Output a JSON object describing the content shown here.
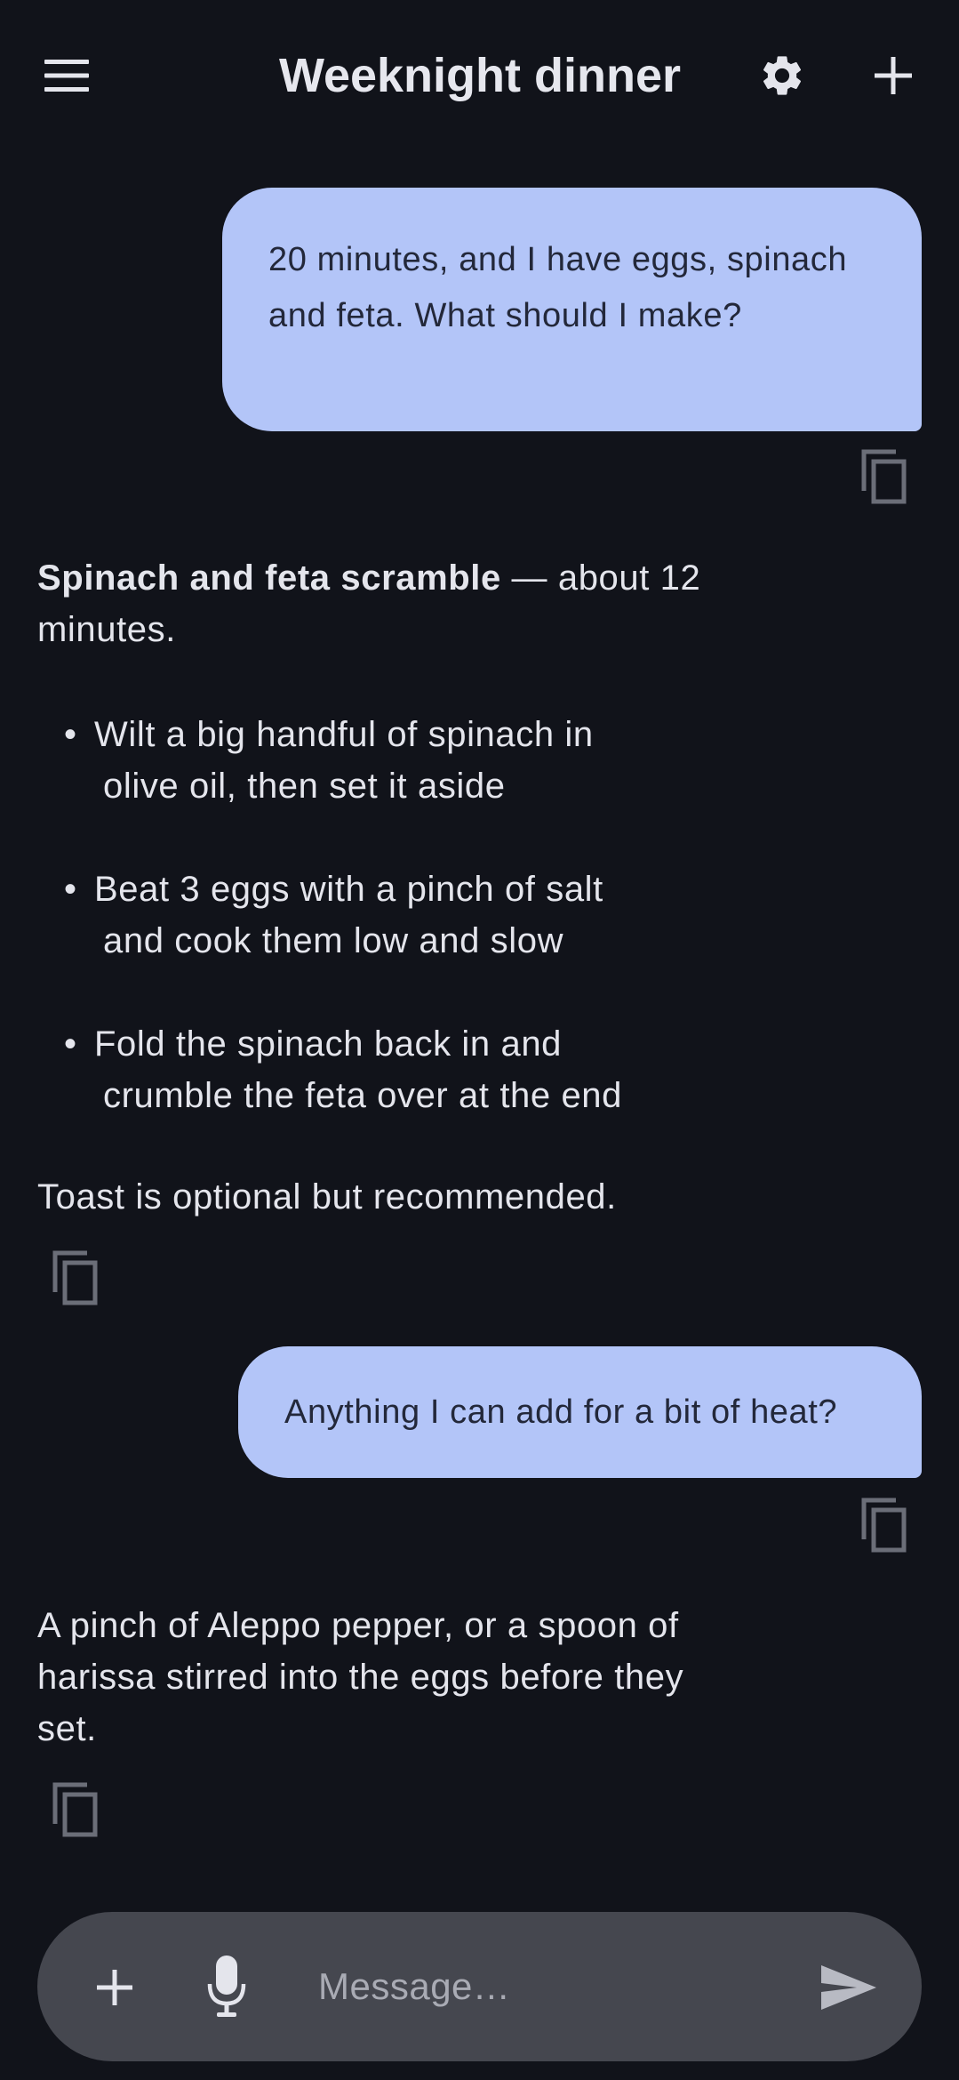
{
  "header": {
    "title": "Weeknight dinner",
    "icons": {
      "menu": "menu-icon",
      "settings": "gear-icon",
      "new": "plus-icon"
    }
  },
  "messages": [
    {
      "role": "user",
      "text": "20 minutes, and I have eggs, spinach and feta. What should I make?"
    },
    {
      "role": "assistant",
      "intro_bold": "Spinach and feta scramble",
      "intro_rest": " — about 12 minutes.",
      "bullets": [
        {
          "line1": "Wilt a big handful of spinach in",
          "line2": "olive oil, then set it aside"
        },
        {
          "line1": "Beat 3 eggs with a pinch of salt",
          "line2": "and cook them low and slow"
        },
        {
          "line1": "Fold the spinach back in and",
          "line2": "crumble the feta over at the end"
        }
      ],
      "outro": "Toast is optional but recommended."
    },
    {
      "role": "user",
      "text": "Anything I can add for a bit of heat?"
    },
    {
      "role": "assistant",
      "text": "A pinch of Aleppo pepper, or a spoon of harissa stirred into the eggs before they set."
    }
  ],
  "composer": {
    "placeholder": "Message…",
    "icons": {
      "add": "plus-icon",
      "mic": "microphone-icon",
      "send": "send-icon"
    }
  },
  "colors": {
    "background": "#11131a",
    "user_bubble": "#b3c5f8",
    "user_text": "#23283a",
    "assistant_text": "#e4e5ec",
    "composer_bg": "#45474f",
    "icon_muted": "#6b6e78"
  }
}
